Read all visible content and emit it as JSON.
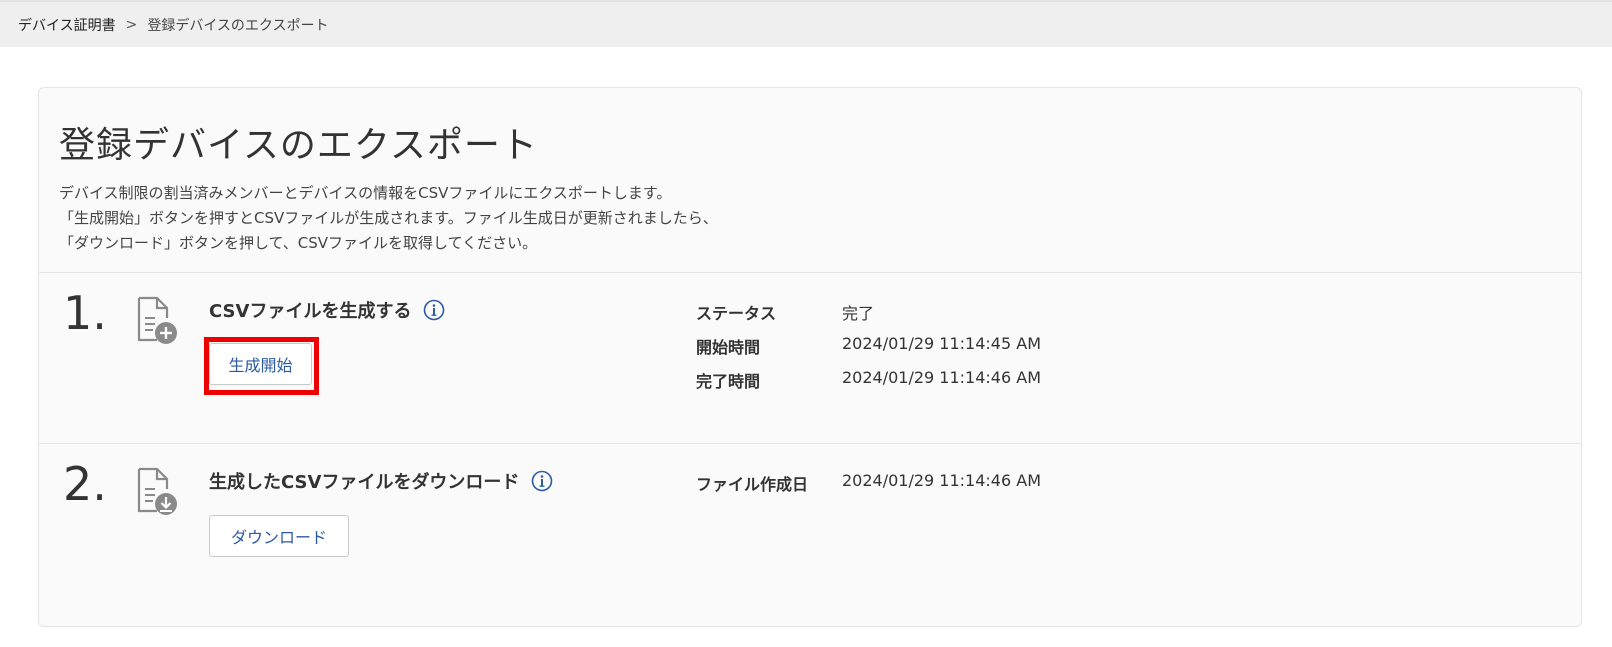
{
  "breadcrumb": {
    "parent": "デバイス証明書",
    "separator": ">",
    "current": "登録デバイスのエクスポート"
  },
  "page": {
    "title": "登録デバイスのエクスポート",
    "description": [
      "デバイス制限の割当済みメンバーとデバイスの情報をCSVファイルにエクスポートします。",
      "「生成開始」ボタンを押すとCSVファイルが生成されます。ファイル生成日が更新されましたら、",
      "「ダウンロード」ボタンを押して、CSVファイルを取得してください。"
    ]
  },
  "steps": [
    {
      "number": "1.",
      "icon": "file-add-icon",
      "title": "CSVファイルを生成する",
      "button_label": "生成開始",
      "info": [
        {
          "label": "ステータス",
          "value": "完了"
        },
        {
          "label": "開始時間",
          "value": "2024/01/29 11:14:45 AM"
        },
        {
          "label": "完了時間",
          "value": "2024/01/29 11:14:46 AM"
        }
      ]
    },
    {
      "number": "2.",
      "icon": "file-download-icon",
      "title": "生成したCSVファイルをダウンロード",
      "button_label": "ダウンロード",
      "info": [
        {
          "label": "ファイル作成日",
          "value": "2024/01/29 11:14:46 AM"
        }
      ]
    }
  ],
  "colors": {
    "link_blue": "#2b5aa6",
    "highlight_red": "#ee0000",
    "icon_gray": "#8a8a8a"
  }
}
